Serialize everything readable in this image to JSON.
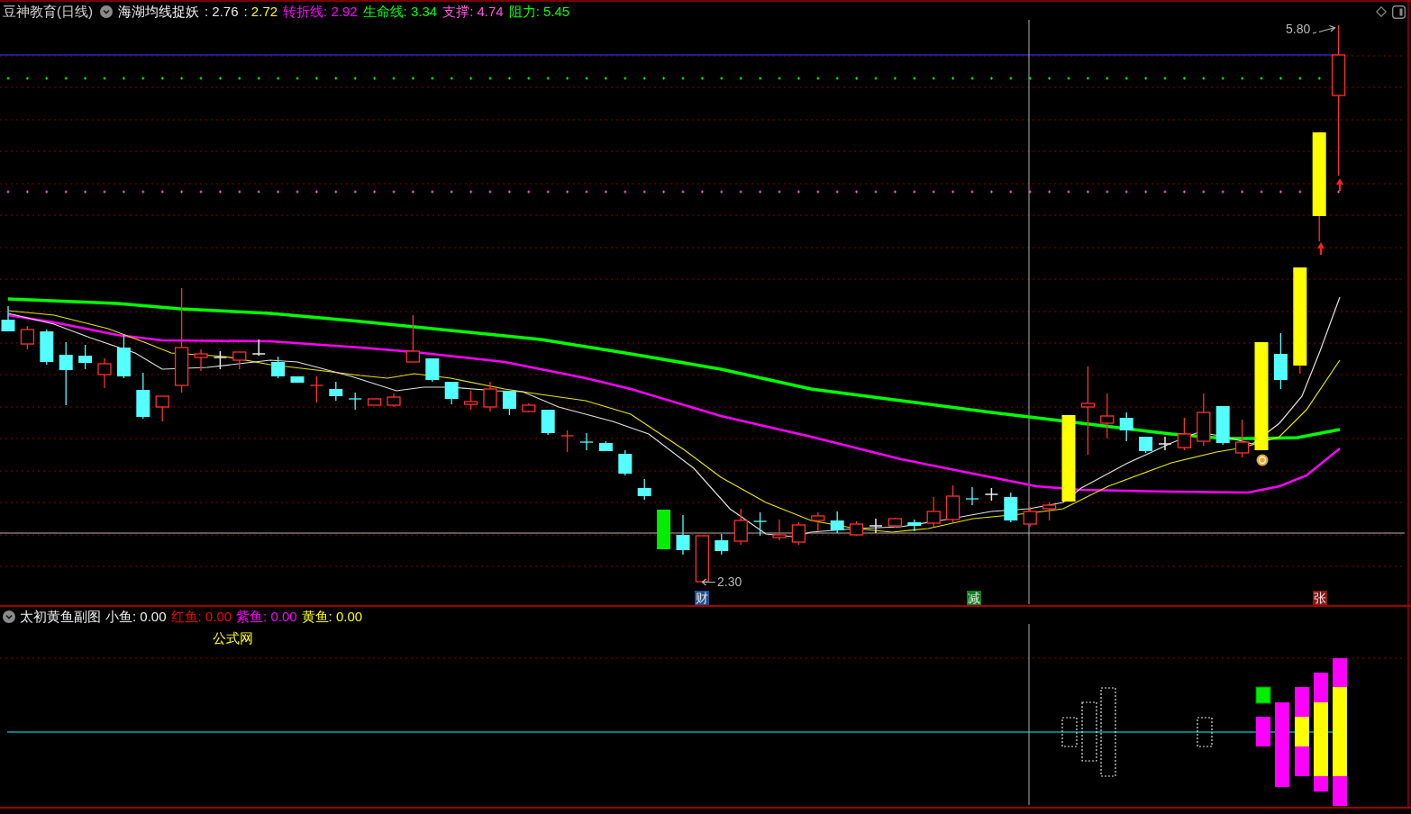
{
  "main_chart": {
    "title": "豆神教育(日线)",
    "indicator": "海湖均线捉妖",
    "readouts": [
      {
        "text": ": 2.76",
        "color": "#e8e8e8"
      },
      {
        "text": ": 2.72",
        "color": "#ffff00"
      },
      {
        "text": "转折线: 2.92",
        "color": "#ff00ff"
      },
      {
        "text": "生命线: 3.34",
        "color": "#00ff00"
      },
      {
        "text": "支撑: 4.74",
        "color": "#ff55dd"
      },
      {
        "text": "阻力: 5.45",
        "color": "#00ff00"
      }
    ],
    "price_labels": [
      {
        "kind": "high",
        "text": "5.80"
      },
      {
        "kind": "low",
        "text": "2.30"
      }
    ],
    "event_markers": [
      {
        "text": "财",
        "color": "#1f4e8f"
      },
      {
        "text": "减",
        "color": "#0f7d22"
      },
      {
        "text": "张",
        "color": "#8c1414"
      }
    ]
  },
  "sub_chart": {
    "title": "太初黄鱼副图",
    "readouts": [
      {
        "text": "小鱼: 0.00",
        "color": "#f0f0f0"
      },
      {
        "text": "红鱼: 0.00",
        "color": "#ff0000"
      },
      {
        "text": "紫鱼: 0.00",
        "color": "#ff00ff"
      },
      {
        "text": "黄鱼: 0.00",
        "color": "#ffff00"
      }
    ],
    "note": "公式网"
  }
}
